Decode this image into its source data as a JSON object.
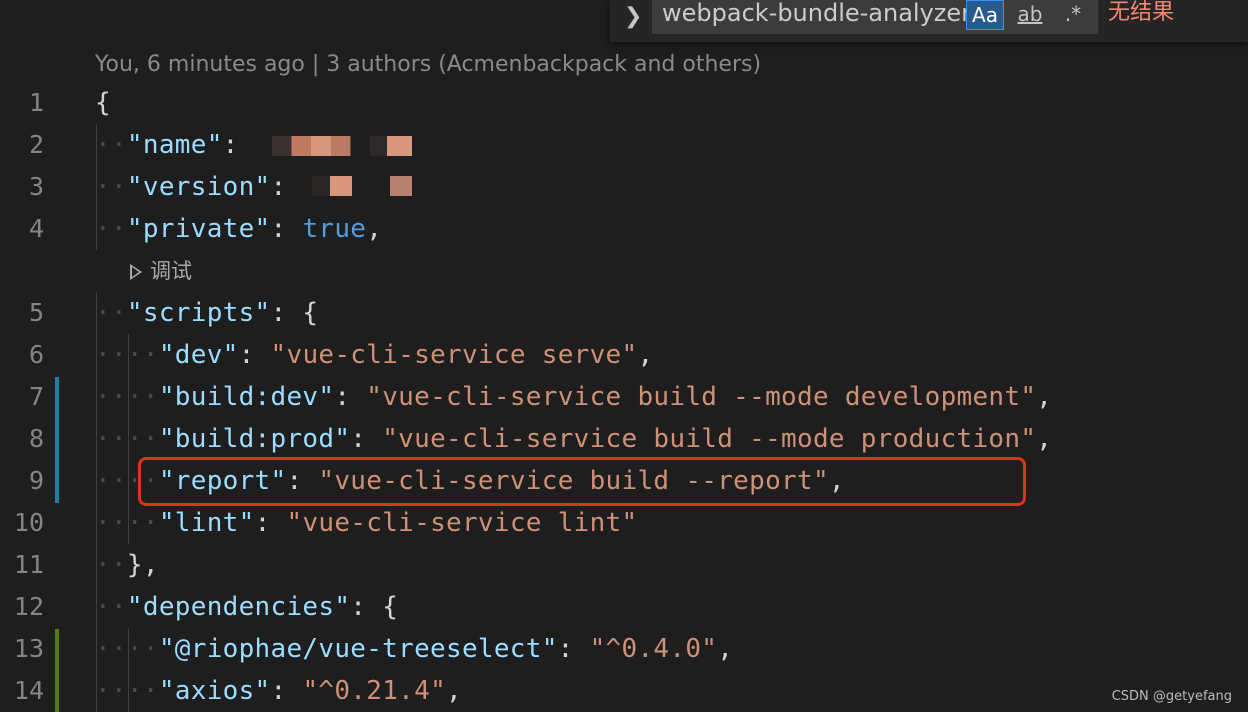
{
  "blame": "You, 6 minutes ago | 3 authors (Acmenbackpack and others)",
  "codelens": "调试",
  "find": {
    "value": "webpack-bundle-analyzer",
    "match_case": "Aa",
    "whole_word": "ab",
    "regex": ".*",
    "result": "无结果"
  },
  "lines": [
    {
      "num": "1",
      "tokens": [
        {
          "t": "{",
          "c": "p"
        }
      ]
    },
    {
      "num": "2",
      "tokens": [
        {
          "t": "\"name\"",
          "c": "k"
        },
        {
          "t": ": ",
          "c": "p"
        }
      ]
    },
    {
      "num": "3",
      "tokens": [
        {
          "t": "\"version\"",
          "c": "k"
        },
        {
          "t": ": ",
          "c": "p"
        }
      ]
    },
    {
      "num": "4",
      "tokens": [
        {
          "t": "\"private\"",
          "c": "k"
        },
        {
          "t": ": ",
          "c": "p"
        },
        {
          "t": "true",
          "c": "b"
        },
        {
          "t": ",",
          "c": "p"
        }
      ]
    },
    {
      "num": "5",
      "tokens": [
        {
          "t": "\"scripts\"",
          "c": "k"
        },
        {
          "t": ": {",
          "c": "p"
        }
      ]
    },
    {
      "num": "6",
      "tokens": [
        {
          "t": "\"dev\"",
          "c": "k"
        },
        {
          "t": ": ",
          "c": "p"
        },
        {
          "t": "\"vue-cli-service serve\"",
          "c": "s"
        },
        {
          "t": ",",
          "c": "p"
        }
      ]
    },
    {
      "num": "7",
      "tokens": [
        {
          "t": "\"build:dev\"",
          "c": "k"
        },
        {
          "t": ": ",
          "c": "p"
        },
        {
          "t": "\"vue-cli-service build --mode development\"",
          "c": "s"
        },
        {
          "t": ",",
          "c": "p"
        }
      ]
    },
    {
      "num": "8",
      "tokens": [
        {
          "t": "\"build:prod\"",
          "c": "k"
        },
        {
          "t": ": ",
          "c": "p"
        },
        {
          "t": "\"vue-cli-service build --mode production\"",
          "c": "s"
        },
        {
          "t": ",",
          "c": "p"
        }
      ]
    },
    {
      "num": "9",
      "tokens": [
        {
          "t": "\"report\"",
          "c": "k"
        },
        {
          "t": ": ",
          "c": "p"
        },
        {
          "t": "\"vue-cli-service build --report\"",
          "c": "s"
        },
        {
          "t": ",",
          "c": "p"
        }
      ]
    },
    {
      "num": "10",
      "tokens": [
        {
          "t": "\"lint\"",
          "c": "k"
        },
        {
          "t": ": ",
          "c": "p"
        },
        {
          "t": "\"vue-cli-service lint\"",
          "c": "s"
        }
      ]
    },
    {
      "num": "11",
      "tokens": [
        {
          "t": "},",
          "c": "p"
        }
      ]
    },
    {
      "num": "12",
      "tokens": [
        {
          "t": "\"dependencies\"",
          "c": "k"
        },
        {
          "t": ": {",
          "c": "p"
        }
      ]
    },
    {
      "num": "13",
      "tokens": [
        {
          "t": "\"@riophae/vue-treeselect\"",
          "c": "k"
        },
        {
          "t": ": ",
          "c": "p"
        },
        {
          "t": "\"^0.4.0\"",
          "c": "s"
        },
        {
          "t": ",",
          "c": "p"
        }
      ]
    },
    {
      "num": "14",
      "tokens": [
        {
          "t": "\"axios\"",
          "c": "k"
        },
        {
          "t": ": ",
          "c": "p"
        },
        {
          "t": "\"^0.21.4\"",
          "c": "s"
        },
        {
          "t": ",",
          "c": "p"
        }
      ]
    }
  ],
  "colors": {
    "git_modified": "#1b81a8",
    "git_added": "#587c0c",
    "highlight_border": "#e0301e"
  },
  "watermark": "CSDN @getyefang"
}
